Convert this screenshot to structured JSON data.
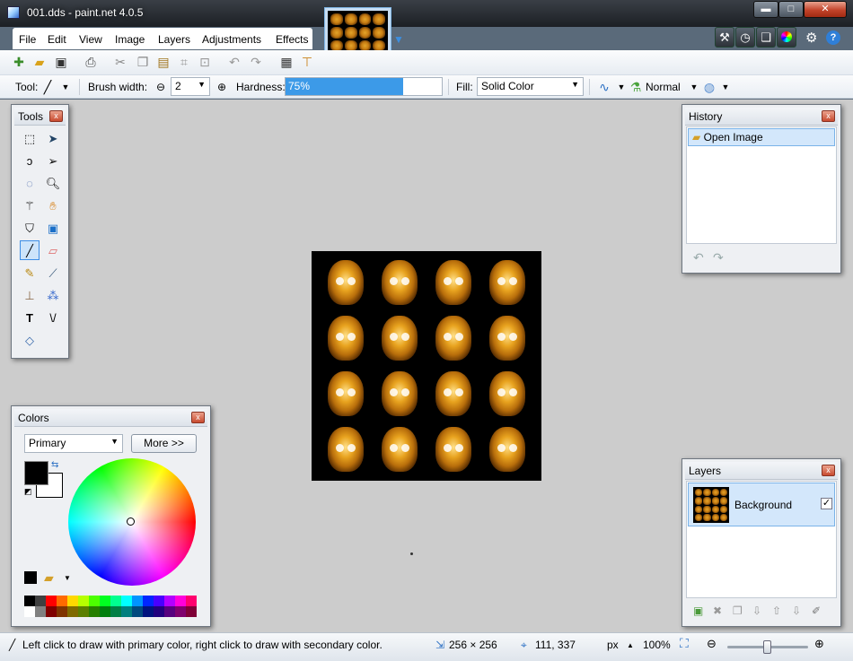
{
  "window": {
    "title": "001.dds - paint.net 4.0.5",
    "min": "▬",
    "max": "□",
    "close": "✕"
  },
  "menu": [
    "File",
    "Edit",
    "View",
    "Image",
    "Layers",
    "Adjustments",
    "Effects"
  ],
  "toolbar_icons": [
    "new-icon",
    "open-icon",
    "save-icon",
    "print-icon",
    "cut-icon",
    "copy-icon",
    "paste-icon",
    "crop-icon",
    "deselect-icon",
    "undo-icon",
    "redo-icon",
    "grid-icon",
    "ruler-icon"
  ],
  "options": {
    "tool_label": "Tool:",
    "brush_width_label": "Brush width:",
    "brush_width": "2",
    "hardness_label": "Hardness:",
    "hardness": "75%",
    "hardness_fraction": 0.75,
    "fill_label": "Fill:",
    "fill": "Solid Color",
    "blend": "Normal"
  },
  "tools_panel": {
    "title": "Tools",
    "close": "x"
  },
  "history_panel": {
    "title": "History",
    "close": "x",
    "item": "Open Image"
  },
  "colors_panel": {
    "title": "Colors",
    "close": "x",
    "mode": "Primary",
    "more": "More >>",
    "primary": "#000000",
    "secondary": "#ffffff"
  },
  "layers_panel": {
    "title": "Layers",
    "close": "x",
    "layer": "Background",
    "visible": "✓"
  },
  "status": {
    "hint": "Left click to draw with primary color, right click to draw with secondary color.",
    "size": "256 × 256",
    "pos": "111, 337",
    "unit": "px",
    "zoom": "100%"
  },
  "palette_top": [
    "#000000",
    "#3f3f3f",
    "#ff0000",
    "#ff6a00",
    "#ffd800",
    "#b6ff00",
    "#4cff00",
    "#00ff21",
    "#00ff90",
    "#00ffff",
    "#0094ff",
    "#0026ff",
    "#4800ff",
    "#b200ff",
    "#ff00dc",
    "#ff006e"
  ],
  "palette_bottom": [
    "#ffffff",
    "#808080",
    "#7f0000",
    "#7f3300",
    "#7f6a00",
    "#5b7f00",
    "#267f00",
    "#007f0e",
    "#007f46",
    "#007f7f",
    "#004a7f",
    "#00137f",
    "#21007f",
    "#57007f",
    "#7f006e",
    "#7f0037"
  ]
}
